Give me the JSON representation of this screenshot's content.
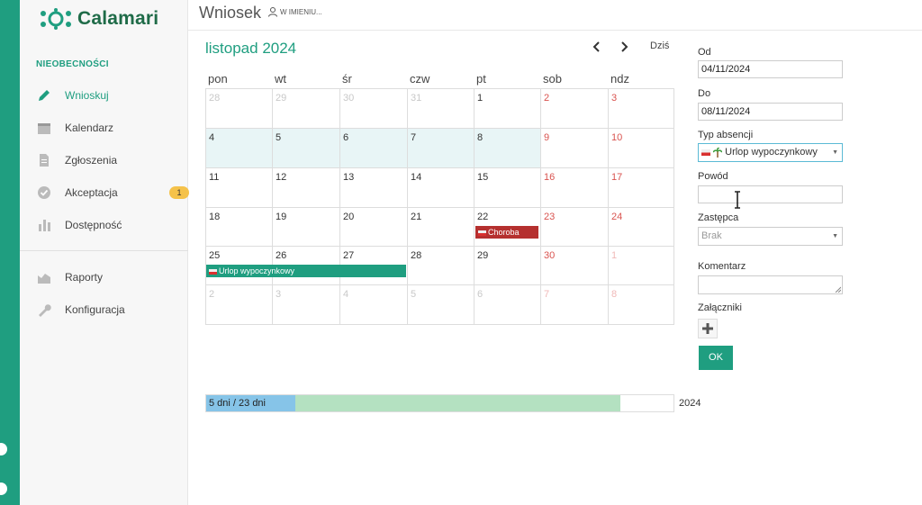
{
  "app": {
    "name": "Calamari",
    "brand_color": "#1f9e80"
  },
  "sidebar": {
    "section_title": "NIEOBECNOŚCI",
    "items": [
      {
        "label": "Wnioskuj",
        "icon": "pencil-icon",
        "active": true
      },
      {
        "label": "Kalendarz",
        "icon": "calendar-icon"
      },
      {
        "label": "Zgłoszenia",
        "icon": "document-icon"
      },
      {
        "label": "Akceptacja",
        "icon": "check-circle-icon",
        "badge": "1"
      },
      {
        "label": "Dostępność",
        "icon": "bar-chart-icon"
      },
      {
        "label": "Raporty",
        "icon": "area-chart-icon"
      },
      {
        "label": "Konfiguracja",
        "icon": "wrench-icon"
      }
    ]
  },
  "header": {
    "title": "Wniosek",
    "on_behalf": "W IMIENIU..."
  },
  "calendar": {
    "month_title": "listopad 2024",
    "today_label": "Dziś",
    "weekdays": [
      "pon",
      "wt",
      "śr",
      "czw",
      "pt",
      "sob",
      "ndz"
    ],
    "weeks": [
      [
        "28",
        "29",
        "30",
        "31",
        "1",
        "2",
        "3"
      ],
      [
        "4",
        "5",
        "6",
        "7",
        "8",
        "9",
        "10"
      ],
      [
        "11",
        "12",
        "13",
        "14",
        "15",
        "16",
        "17"
      ],
      [
        "18",
        "19",
        "20",
        "21",
        "22",
        "23",
        "24"
      ],
      [
        "25",
        "26",
        "27",
        "28",
        "29",
        "30",
        "1"
      ],
      [
        "2",
        "3",
        "4",
        "5",
        "6",
        "7",
        "8"
      ]
    ],
    "events": [
      {
        "label": "Choroba",
        "color": "#b5302f"
      },
      {
        "label": "Urlop wypoczynkowy",
        "color": "#1f9e80"
      }
    ]
  },
  "form": {
    "from_label": "Od",
    "from_value": "04/11/2024",
    "to_label": "Do",
    "to_value": "08/11/2024",
    "type_label": "Typ absencji",
    "type_value": "Urlop wypoczynkowy",
    "reason_label": "Powód",
    "reason_value": "",
    "substitute_label": "Zastępca",
    "substitute_value": "Brak",
    "comment_label": "Komentarz",
    "attachments_label": "Załączniki",
    "ok_label": "OK"
  },
  "quota": {
    "label": "5 dni / 23 dni",
    "used_days": 5,
    "total_days": 23,
    "year": "2024",
    "used_color": "#86c4e8",
    "available_color": "#b4e1c1"
  }
}
